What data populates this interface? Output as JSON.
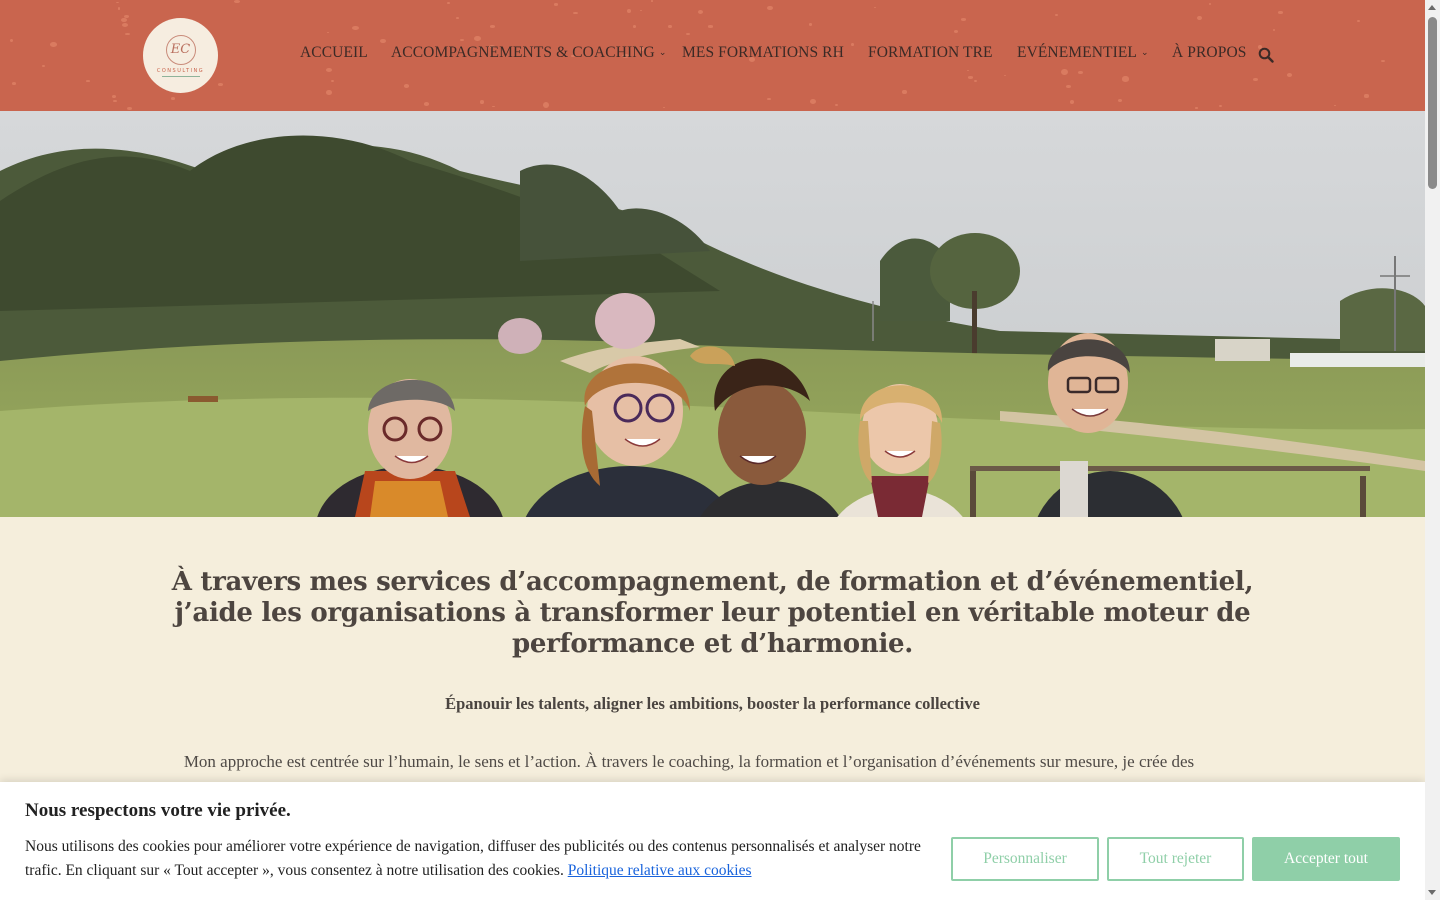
{
  "header": {
    "logo": {
      "monogram": "EC",
      "text": "CONSULTING"
    },
    "nav": [
      {
        "label": "ACCUEIL",
        "has_dropdown": false
      },
      {
        "label": "ACCOMPAGNEMENTS & COACHING",
        "has_dropdown": true
      },
      {
        "label": "MES FORMATIONS RH",
        "has_dropdown": false
      },
      {
        "label": "FORMATION TRE",
        "has_dropdown": false
      },
      {
        "label": "EVÉNEMENTIEL",
        "has_dropdown": true
      },
      {
        "label": "À PROPOS",
        "has_dropdown": false
      }
    ],
    "search_icon": "search-icon",
    "colors": {
      "background": "#c9654e",
      "text": "#3b2a26"
    }
  },
  "hero": {
    "image": "group-photo-outdoor-field"
  },
  "content": {
    "headline": "À travers mes services d’accompagnement, de formation et d’événementiel, j’aide les organisations à transformer leur potentiel en véritable moteur de performance et d’harmonie.",
    "subtitle": "Épanouir les talents, aligner les ambitions, booster la performance collective",
    "body": "Mon approche est centrée sur l’humain, le sens et l’action. À travers le coaching, la formation et l’organisation d’événements sur mesure, je crée des",
    "background": "#f5eedc"
  },
  "cookie_banner": {
    "title": "Nous respectons votre vie privée.",
    "text": "Nous utilisons des cookies pour améliorer votre expérience de navigation, diffuser des publicités ou des contenus personnalisés et analyser notre trafic. En cliquant sur « Tout accepter », vous consentez à notre utilisation des cookies.",
    "link_label": "Politique relative aux cookies",
    "buttons": {
      "customize": "Personnaliser",
      "reject": "Tout rejeter",
      "accept": "Accepter tout"
    },
    "accent_color": "#8fcfa8"
  }
}
